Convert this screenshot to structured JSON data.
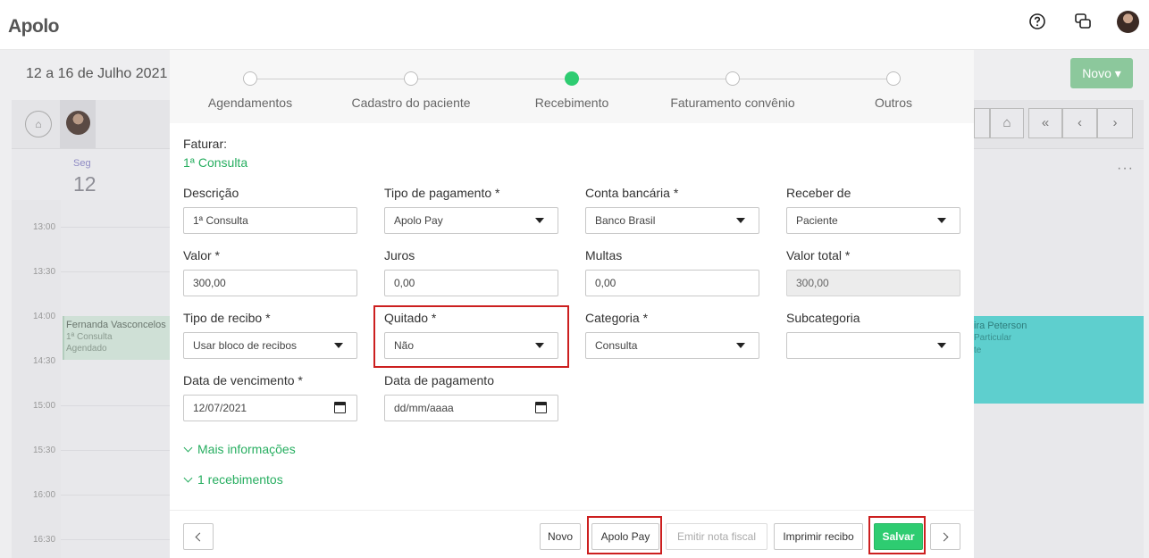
{
  "app": {
    "logo": "Apolo"
  },
  "calendar": {
    "title": "12 a 16 de Julho 2021",
    "novo_label": "Novo ▾",
    "day_name": "Seg",
    "day_number": "12",
    "times": [
      "13:00",
      "13:30",
      "14:00",
      "14:30",
      "15:00",
      "15:30",
      "16:00",
      "16:30"
    ],
    "appointment_left": {
      "name": "Fernanda Vasconcelos",
      "type": "1ª Consulta",
      "status": "Agendado"
    },
    "appointment_right": {
      "name": "ira Peterson",
      "type": "Particular",
      "status": "te"
    }
  },
  "modal": {
    "steps": [
      {
        "label": "Agendamentos",
        "active": false
      },
      {
        "label": "Cadastro do paciente",
        "active": false
      },
      {
        "label": "Recebimento",
        "active": true
      },
      {
        "label": "Faturamento convênio",
        "active": false
      },
      {
        "label": "Outros",
        "active": false
      }
    ],
    "faturar_label": "Faturar:",
    "faturar_value": "1ª Consulta",
    "fields": {
      "descricao": {
        "label": "Descrição",
        "value": "1ª Consulta"
      },
      "tipo_pagamento": {
        "label": "Tipo de pagamento *",
        "value": "Apolo Pay"
      },
      "conta_bancaria": {
        "label": "Conta bancária *",
        "value": "Banco Brasil"
      },
      "receber_de": {
        "label": "Receber de",
        "value": "Paciente"
      },
      "valor": {
        "label": "Valor *",
        "value": "300,00"
      },
      "juros": {
        "label": "Juros",
        "value": "0,00"
      },
      "multas": {
        "label": "Multas",
        "value": "0,00"
      },
      "valor_total": {
        "label": "Valor total *",
        "value": "300,00"
      },
      "tipo_recibo": {
        "label": "Tipo de recibo *",
        "value": "Usar bloco de recibos"
      },
      "quitado": {
        "label": "Quitado *",
        "value": "Não"
      },
      "categoria": {
        "label": "Categoria *",
        "value": "Consulta"
      },
      "subcategoria": {
        "label": "Subcategoria",
        "value": ""
      },
      "data_vencimento": {
        "label": "Data de vencimento *",
        "value": "12/07/2021"
      },
      "data_pagamento": {
        "label": "Data de pagamento",
        "value": "dd/mm/aaaa"
      }
    },
    "more_info": "Mais informações",
    "receipts": "1 recebimentos",
    "buttons": {
      "novo": "Novo",
      "apolo_pay": "Apolo Pay",
      "emitir_nota": "Emitir nota fiscal",
      "imprimir_recibo": "Imprimir recibo",
      "salvar": "Salvar"
    }
  },
  "colors": {
    "accent": "#2ecc71",
    "highlight": "#cc1f1f"
  }
}
